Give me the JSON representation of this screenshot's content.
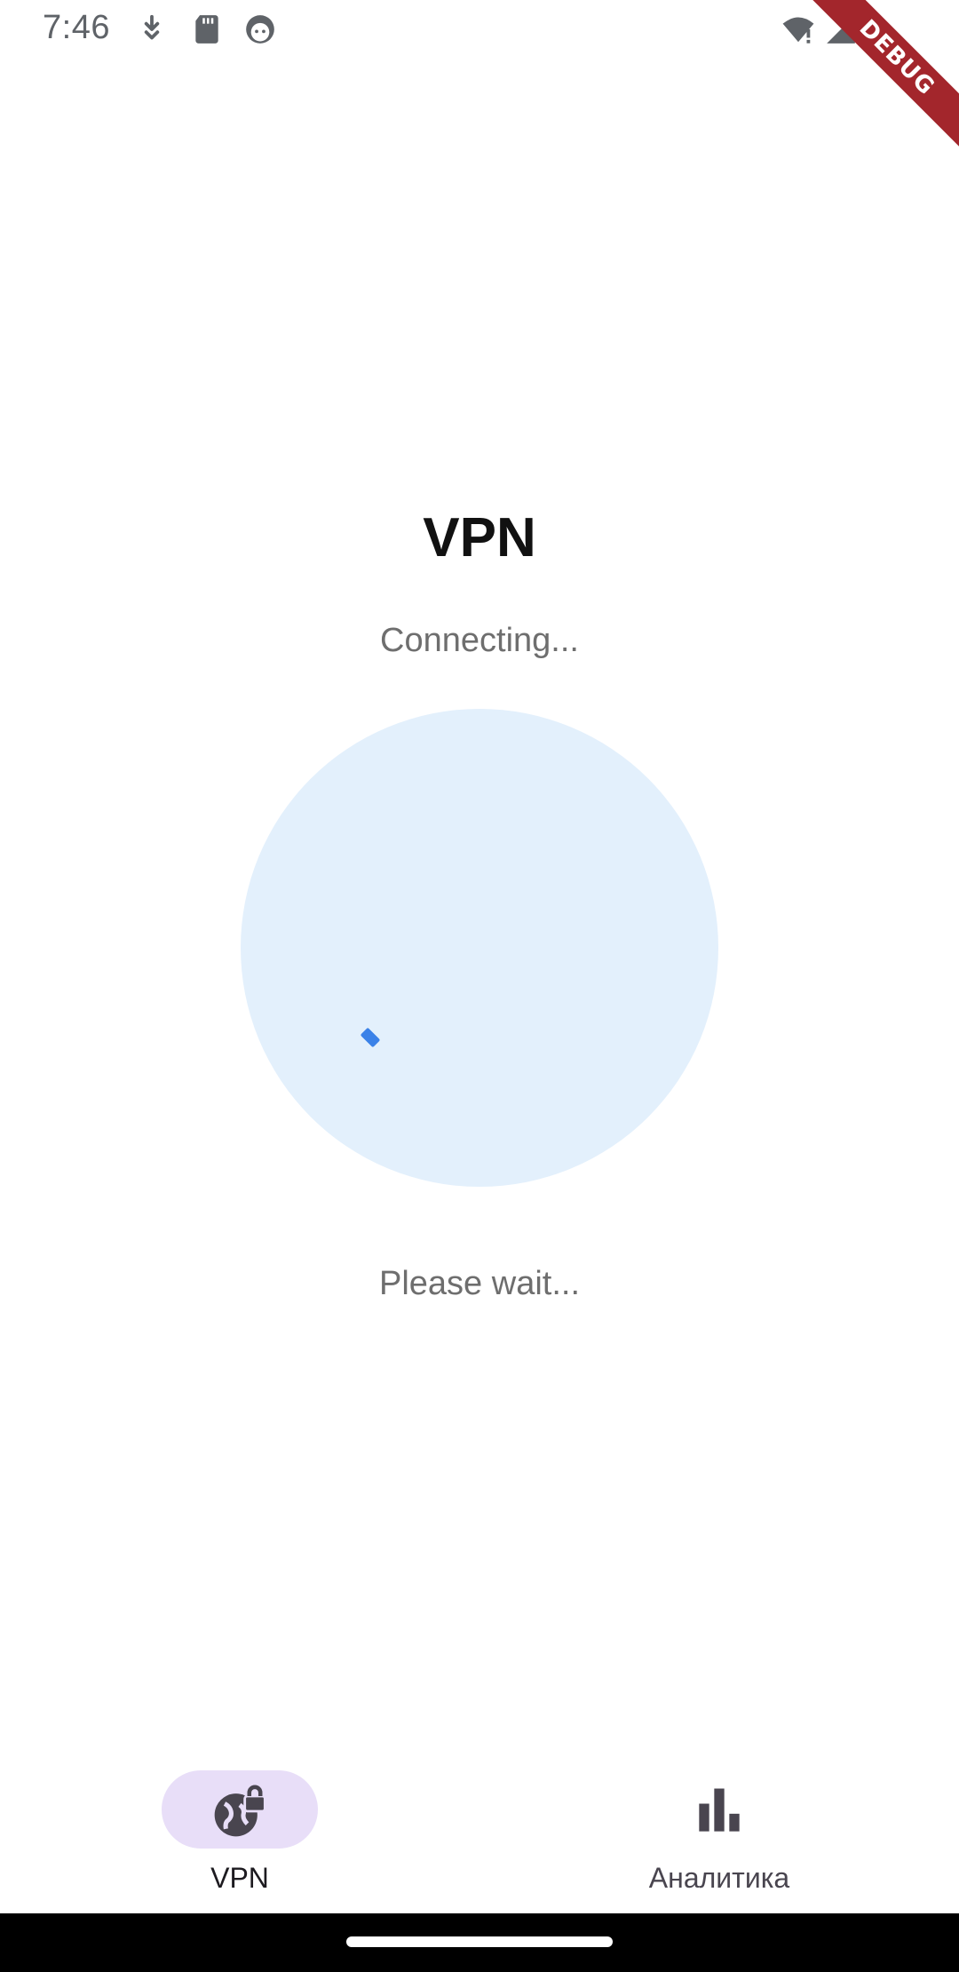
{
  "status_bar": {
    "time": "7:46",
    "icons": [
      "download-icon",
      "sd-card-icon",
      "android-face-icon",
      "wifi-alert-icon",
      "cell-signal-icon"
    ]
  },
  "debug_banner": {
    "label": "DEBUG",
    "color": "#a3262c"
  },
  "main": {
    "title": "VPN",
    "connection_status": "Connecting...",
    "wait_message": "Please wait...",
    "circle_color": "#e3f0fc",
    "spinner_color": "#3b82e8"
  },
  "bottom_nav": {
    "items": [
      {
        "label": "VPN",
        "icon": "vpn-globe-lock-icon",
        "selected": true
      },
      {
        "label": "Аналитика",
        "icon": "bar-chart-icon",
        "selected": false
      }
    ],
    "selected_pill_color": "#e8def8"
  }
}
